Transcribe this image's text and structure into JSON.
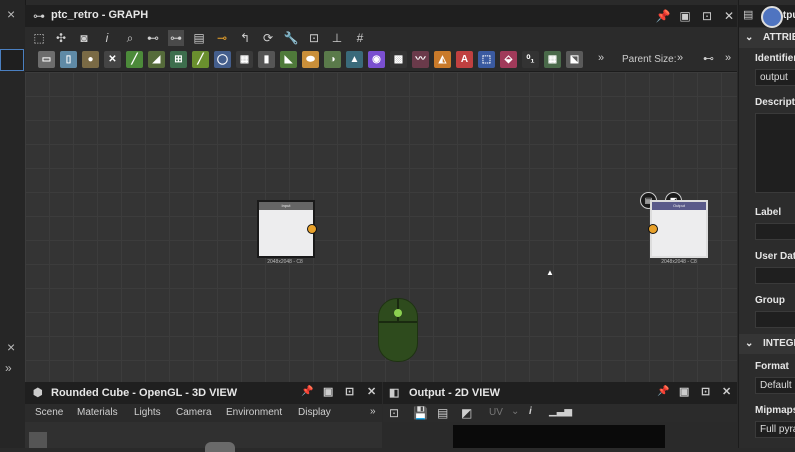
{
  "graph": {
    "title": "ptc_retro - GRAPH",
    "parent_size_label": "Parent Size:",
    "more": "»",
    "nodes": [
      {
        "header": "Input",
        "caption": "2048x2048 - C8"
      },
      {
        "header": "Output",
        "caption": "2048x2048 - C8"
      }
    ]
  },
  "left": {
    "close": "×",
    "expand": "»"
  },
  "view3d": {
    "title": "Rounded Cube - OpenGL - 3D VIEW",
    "tabs": [
      "Scene",
      "Materials",
      "Lights",
      "Camera",
      "Environment",
      "Display"
    ],
    "more": "»"
  },
  "view2d": {
    "title": "Output - 2D VIEW",
    "uv_label": "UV"
  },
  "properties": {
    "title": "Output",
    "attributes_section": "ATTRIBUTES",
    "identifier_label": "Identifier",
    "identifier_value": "output",
    "description_label": "Description",
    "label_label": "Label",
    "user_data_label": "User Data",
    "group_label": "Group",
    "integer_section": "INTEGER",
    "format_label": "Format",
    "format_value": "Default",
    "mipmaps_label": "Mipmaps",
    "mipmaps_value": "Full pyramid"
  },
  "icons": {
    "window": [
      "pin-icon",
      "restore-icon",
      "maximize-icon",
      "close-icon"
    ],
    "accent": "#e8a12a"
  }
}
